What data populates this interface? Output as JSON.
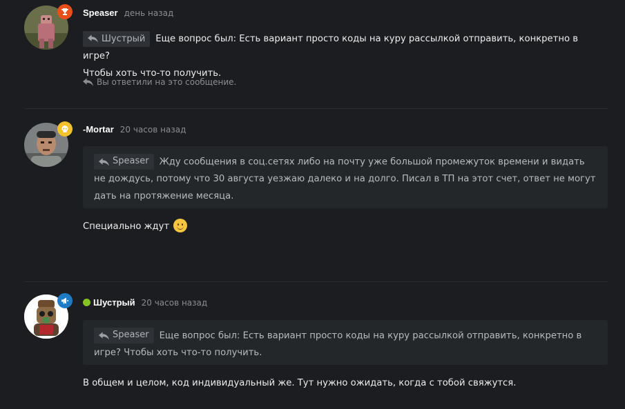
{
  "comments": [
    {
      "author": "Speaser",
      "time": "день назад",
      "badge_icon": "trophy-icon",
      "badge_color": "#e94e1b",
      "quote_author": "Шустрый",
      "text_line1": "Еще вопрос был: Есть вариант просто коды на куру рассылкой отправить, конкретно в игре?",
      "text_line2": "Чтобы хоть что-то получить.",
      "reply_note": "Вы ответили на это сообщение."
    },
    {
      "author": "-Mortar",
      "time": "20 часов назад",
      "badge_icon": "skull-icon",
      "badge_color": "#f2c12e",
      "quote_author": "Speaser",
      "quote_text": "Жду сообщения в соц.сетях либо на почту уже большой промежуток времени и видать не дождусь, потому что 30 августа уезжаю далеко и на долго. Писал в ТП на этот счет, ответ не могут дать на протяжение месяца.",
      "text": "Специально ждут",
      "emoji": "slightly-smiling-face-icon"
    },
    {
      "author": "Шустрый",
      "time": "20 часов назад",
      "online": true,
      "online_color": "#84c225",
      "badge_icon": "megaphone-icon",
      "badge_color": "#1e7bc4",
      "quote_author": "Speaser",
      "quote_text": "Еще вопрос был: Есть вариант просто коды на куру рассылкой отправить, конкретно в игре? Чтобы хоть что-то получить.",
      "text": "В общем и целом, код индивидуальный же. Тут нужно ожидать, когда с тобой свяжутся."
    }
  ]
}
